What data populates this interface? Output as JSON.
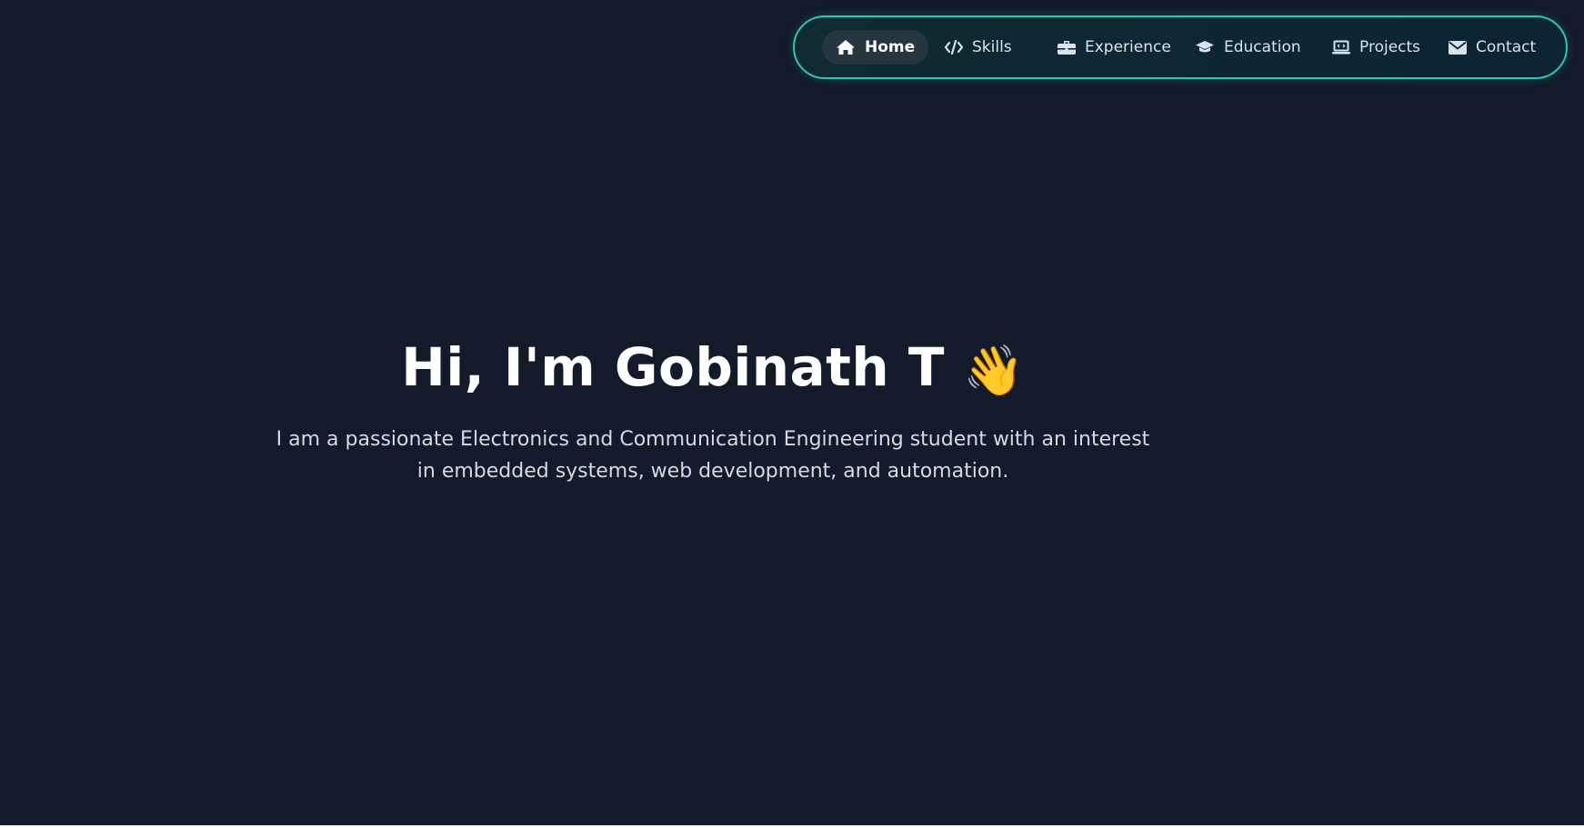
{
  "nav": {
    "items": [
      {
        "label": "Home",
        "icon": "home-icon",
        "active": true
      },
      {
        "label": "Skills",
        "icon": "code-icon",
        "active": false
      },
      {
        "label": "Experience",
        "icon": "briefcase-icon",
        "active": false
      },
      {
        "label": "Education",
        "icon": "graduation-cap-icon",
        "active": false
      },
      {
        "label": "Projects",
        "icon": "laptop-code-icon",
        "active": false
      },
      {
        "label": "Contact",
        "icon": "envelope-icon",
        "active": false
      }
    ]
  },
  "hero": {
    "title": "Hi, I'm Gobinath T",
    "emoji": "👋",
    "description": "I am a passionate Electronics and Communication Engineering student with an interest in embedded systems, web development, and automation."
  },
  "colors": {
    "background": "#131a2a",
    "nav_border": "#2dc6b4",
    "text": "#ffffff"
  }
}
